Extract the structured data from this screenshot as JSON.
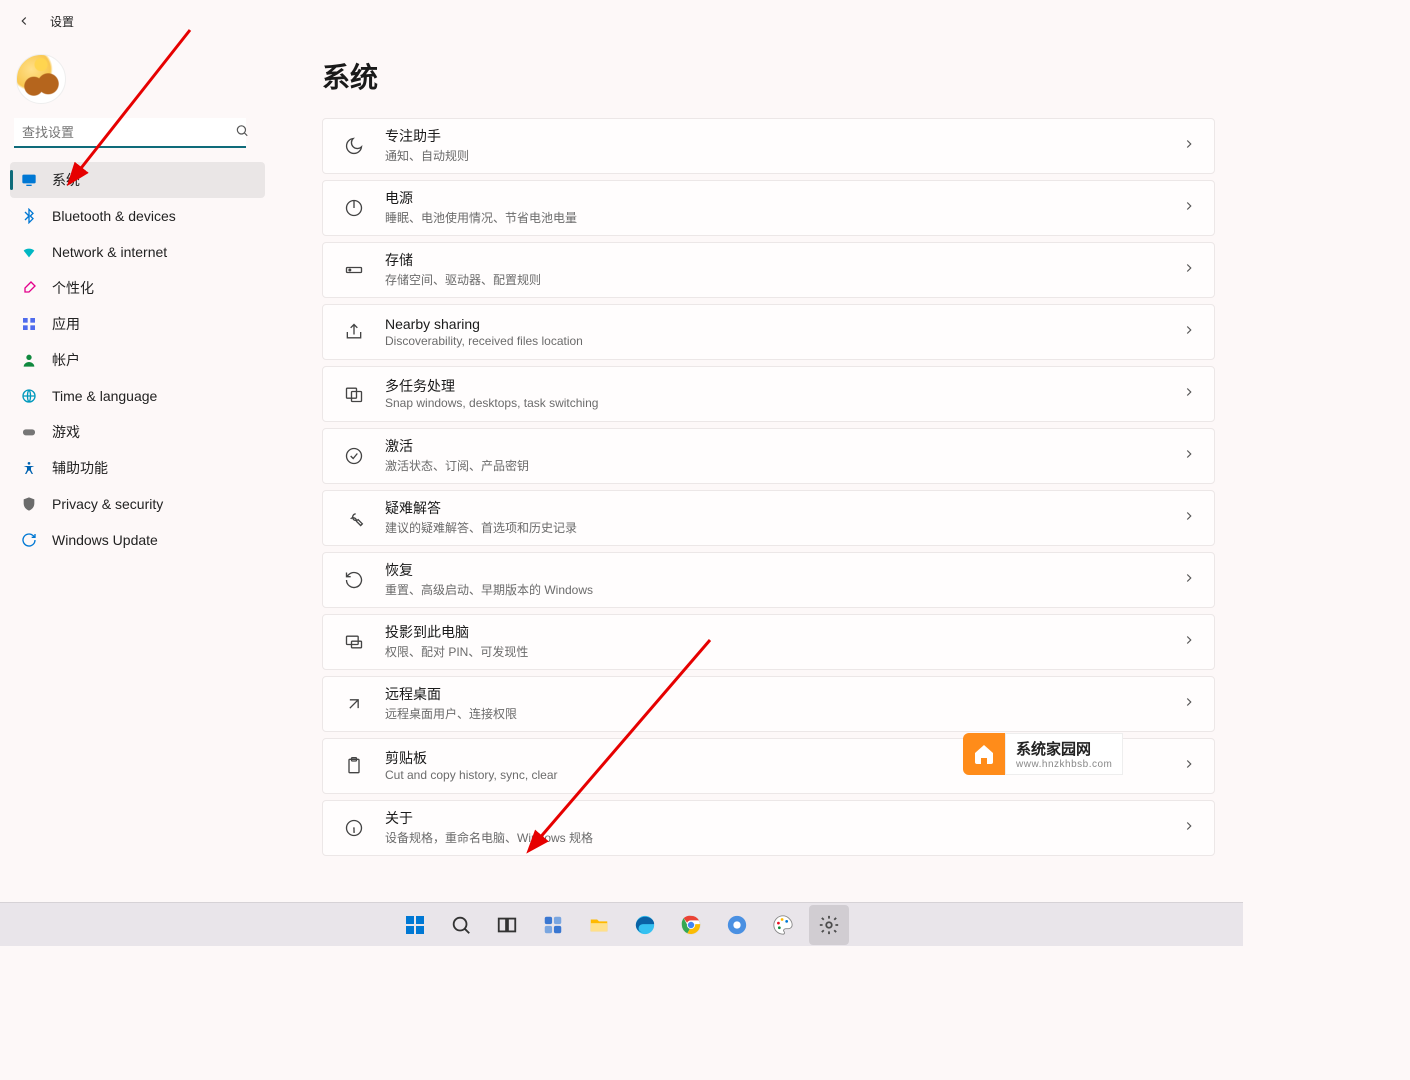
{
  "header": {
    "title": "设置"
  },
  "search": {
    "placeholder": "查找设置"
  },
  "sidebar": {
    "items": [
      {
        "label": "系统",
        "icon": "display-icon",
        "color": "#0078d4",
        "selected": true
      },
      {
        "label": "Bluetooth & devices",
        "icon": "bluetooth-icon",
        "color": "#0078d4"
      },
      {
        "label": "Network & internet",
        "icon": "wifi-icon",
        "color": "#00b7c3"
      },
      {
        "label": "个性化",
        "icon": "brush-icon",
        "color": "#e3008c"
      },
      {
        "label": "应用",
        "icon": "apps-icon",
        "color": "#4f6bed"
      },
      {
        "label": "帐户",
        "icon": "person-icon",
        "color": "#10893e"
      },
      {
        "label": "Time & language",
        "icon": "globe-clock-icon",
        "color": "#0099bc"
      },
      {
        "label": "游戏",
        "icon": "gamepad-icon",
        "color": "#767676"
      },
      {
        "label": "辅助功能",
        "icon": "accessibility-icon",
        "color": "#0063b1"
      },
      {
        "label": "Privacy & security",
        "icon": "shield-icon",
        "color": "#6b6b6b"
      },
      {
        "label": "Windows Update",
        "icon": "sync-icon",
        "color": "#0078d4"
      }
    ]
  },
  "main": {
    "title": "系统",
    "items": [
      {
        "icon": "moon-icon",
        "title": "专注助手",
        "sub": "通知、自动规则"
      },
      {
        "icon": "power-icon",
        "title": "电源",
        "sub": "睡眠、电池使用情况、节省电池电量"
      },
      {
        "icon": "storage-icon",
        "title": "存储",
        "sub": "存储空间、驱动器、配置规则"
      },
      {
        "icon": "share-icon",
        "title": "Nearby sharing",
        "sub": "Discoverability, received files location"
      },
      {
        "icon": "multitask-icon",
        "title": "多任务处理",
        "sub": "Snap windows, desktops, task switching"
      },
      {
        "icon": "check-circle-icon",
        "title": "激活",
        "sub": "激活状态、订阅、产品密钥"
      },
      {
        "icon": "wrench-icon",
        "title": "疑难解答",
        "sub": "建议的疑难解答、首选项和历史记录"
      },
      {
        "icon": "recovery-icon",
        "title": "恢复",
        "sub": "重置、高级启动、早期版本的 Windows"
      },
      {
        "icon": "project-icon",
        "title": "投影到此电脑",
        "sub": "权限、配对 PIN、可发现性"
      },
      {
        "icon": "remote-icon",
        "title": "远程桌面",
        "sub": "远程桌面用户、连接权限"
      },
      {
        "icon": "clipboard-icon",
        "title": "剪贴板",
        "sub": "Cut and copy history, sync, clear"
      },
      {
        "icon": "info-icon",
        "title": "关于",
        "sub": "设备规格，重命名电脑、Windows 规格"
      }
    ]
  },
  "taskbar": {
    "items": [
      {
        "name": "start-button",
        "color": "#0078d4"
      },
      {
        "name": "search-button",
        "color": "#333"
      },
      {
        "name": "task-view-button",
        "color": "#333"
      },
      {
        "name": "widgets-button",
        "color": "#3a77d1"
      },
      {
        "name": "file-explorer-button",
        "color": "#ffb900"
      },
      {
        "name": "edge-button",
        "color": "#35c1f1"
      },
      {
        "name": "chrome-button",
        "color": "#ea4335"
      },
      {
        "name": "chrome2-button",
        "color": "#4a90e2"
      },
      {
        "name": "paint-button",
        "color": "#e81123"
      },
      {
        "name": "settings-button",
        "color": "#4c4c4c",
        "active": true
      }
    ]
  },
  "watermark": {
    "line1": "系统家园网",
    "line2": "www.hnzkhbsb.com"
  }
}
